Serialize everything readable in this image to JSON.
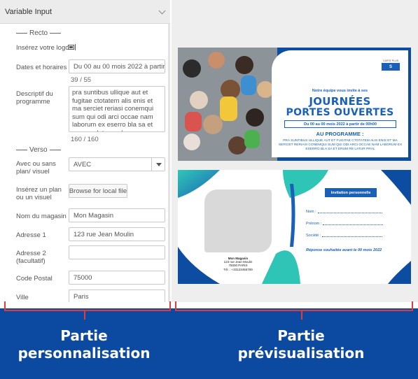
{
  "panel": {
    "title": "Variable Input",
    "recto_label": "Recto",
    "verso_label": "Verso",
    "fields": {
      "logo": {
        "label": "Insérez votre logo"
      },
      "dates": {
        "label": "Dates et horaires",
        "value": "Du 00 au 00 mois 2022 à partir de 00h00",
        "count": "39 / 55"
      },
      "program": {
        "label": "Descriptif du programme",
        "value": "pra suntibus ullique aut et fugitae ctotatem alis enis et ma serciet reriasi conemqui sum qui odi arci occae nam laborum ex eserro bla sa et erum re latur pral",
        "count": "160 / 160"
      },
      "plan_choice": {
        "label": "Avec ou sans plan/ visuel",
        "value": "AVEC"
      },
      "plan_upload": {
        "label": "Insérez un plan ou un visuel",
        "button": "Browse for local file"
      },
      "store_name": {
        "label": "Nom du magasin",
        "value": "Mon Magasin"
      },
      "address1": {
        "label": "Adresse 1",
        "value": "123 rue Jean Moulin"
      },
      "address2": {
        "label": "Adresse 2 (facultatif)",
        "value": ""
      },
      "postal": {
        "label": "Code Postal",
        "value": "75000"
      },
      "city": {
        "label": "Ville",
        "value": "Paris"
      }
    }
  },
  "preview": {
    "recto": {
      "logo_text": "S",
      "logo_caption": "CARTE PLUS",
      "invite": "Notre équipe vous invite à ses",
      "title_line1": "JOURNÉES",
      "title_line2": "PORTES OUVERTES",
      "date": "Du 00 au 00 mois 2022 à partir de 00h00",
      "program_title": "AU PROGRAMME :",
      "program_text": "PRA SUNTIBUS ULLIQUE AUT ET FUGITAE CTOTATEM ALIS ENIS ET MA SERCIET RERIASI CONEMQUI SUM QUI ODI ARCI OCCAE NAM LABORUM EX ESERRO BLA SA ET ERUM RE LATUR PRAL"
    },
    "verso": {
      "store_name": "Mon Magasin",
      "address": "123 rue Jean Moulin",
      "city_line": "75000 PARIS",
      "phone": "Tél. : +33123456789",
      "invitation_button": "Invitation personnelle",
      "nom_label": "Nom :",
      "prenom_label": "Prénom :",
      "societe_label": "Société :",
      "reply": "Réponse souhaitée avant le 00 mois 2022"
    }
  },
  "banner": {
    "left_line1": "Partie",
    "left_line2": "personnalisation",
    "right_line1": "Partie",
    "right_line2": "prévisualisation"
  },
  "colors": {
    "brand_blue": "#0c4da2",
    "accent_red": "#e23a3a",
    "teal": "#2ec4b6"
  }
}
